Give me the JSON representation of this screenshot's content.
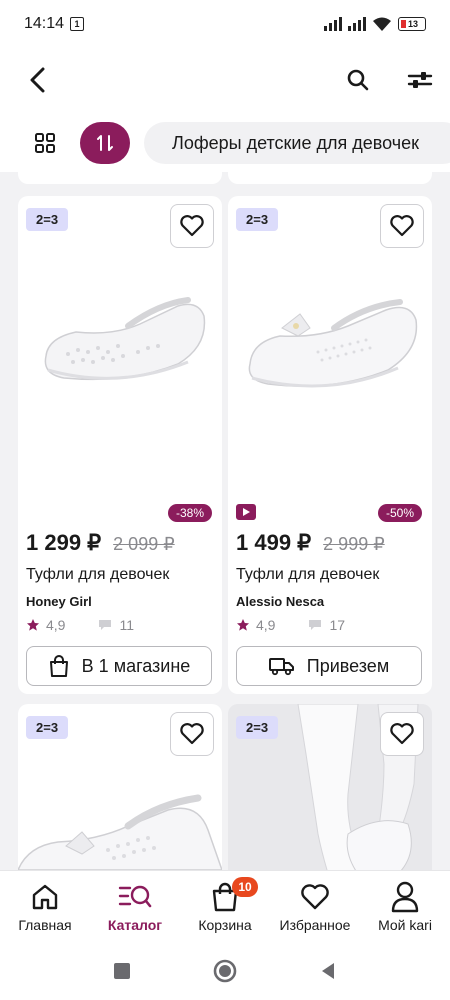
{
  "status_bar": {
    "time": "14:14",
    "notif_count": "1",
    "battery": "13"
  },
  "header": {
    "category_chip": "Лоферы детские для девочек"
  },
  "products": [
    {
      "promo": "2=3",
      "discount": "-38%",
      "price": "1 299 ₽",
      "old_price": "2 099 ₽",
      "title": "Туфли для девочек",
      "brand": "Honey Girl",
      "rating": "4,9",
      "reviews": "11",
      "action_label": "В 1 магазине",
      "action_icon": "shopping-bag-icon"
    },
    {
      "promo": "2=3",
      "discount": "-50%",
      "price": "1 499 ₽",
      "old_price": "2 999 ₽",
      "title": "Туфли для девочек",
      "brand": "Alessio Nesca",
      "rating": "4,9",
      "reviews": "17",
      "action_label": "Привезем",
      "action_icon": "truck-icon"
    },
    {
      "promo": "2=3"
    },
    {
      "promo": "2=3"
    }
  ],
  "bottom_nav": [
    {
      "label": "Главная",
      "icon": "home-icon"
    },
    {
      "label": "Каталог",
      "icon": "catalog-search-icon",
      "active": true
    },
    {
      "label": "Корзина",
      "icon": "cart-bag-icon",
      "badge": "10"
    },
    {
      "label": "Избранное",
      "icon": "heart-icon"
    },
    {
      "label": "Мой kari",
      "icon": "user-icon"
    }
  ],
  "colors": {
    "accent": "#8b1c5c",
    "badge": "#e8481e",
    "promo_bg": "#dcdcfb"
  }
}
